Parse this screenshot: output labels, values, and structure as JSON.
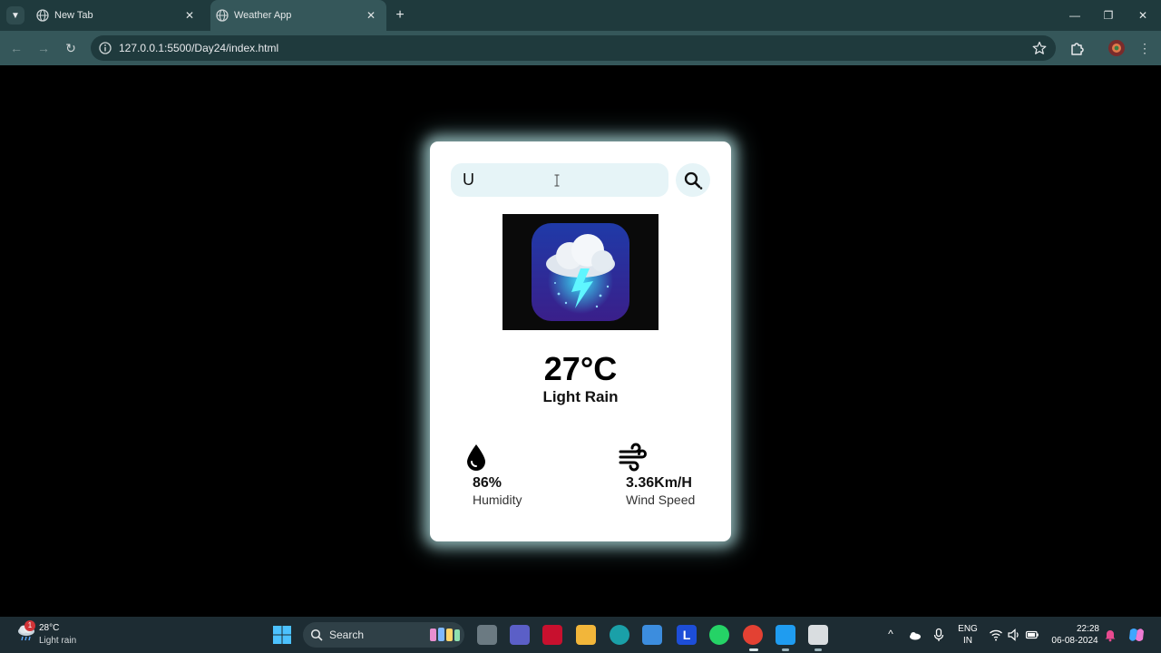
{
  "browser": {
    "tabs": [
      {
        "title": "New Tab"
      },
      {
        "title": "Weather App"
      }
    ],
    "url": "127.0.0.1:5500/Day24/index.html"
  },
  "weather_app": {
    "search": {
      "value": "U",
      "placeholder": ""
    },
    "temperature": "27°C",
    "condition": "Light Rain",
    "humidity": {
      "value": "86%",
      "label": "Humidity"
    },
    "wind": {
      "value": "3.36Km/H",
      "label": "Wind Speed"
    },
    "icons": {
      "search": "search-icon",
      "weather": "thunderstorm-icon",
      "humidity": "water-drop-icon",
      "wind": "wind-icon"
    }
  },
  "taskbar": {
    "weather": {
      "badge": "1",
      "temp": "28°C",
      "desc": "Light rain"
    },
    "search_label": "Search",
    "language": {
      "line1": "ENG",
      "line2": "IN"
    },
    "clock": {
      "time": "22:28",
      "date": "06-08-2024"
    }
  },
  "colors": {
    "chrome_dark": "#1f3a3d",
    "chrome_light": "#35575a",
    "card_bg": "#ffffff",
    "search_bg": "#e6f4f7",
    "page_bg": "#000000",
    "taskbar_bg": "#1d2c33"
  }
}
